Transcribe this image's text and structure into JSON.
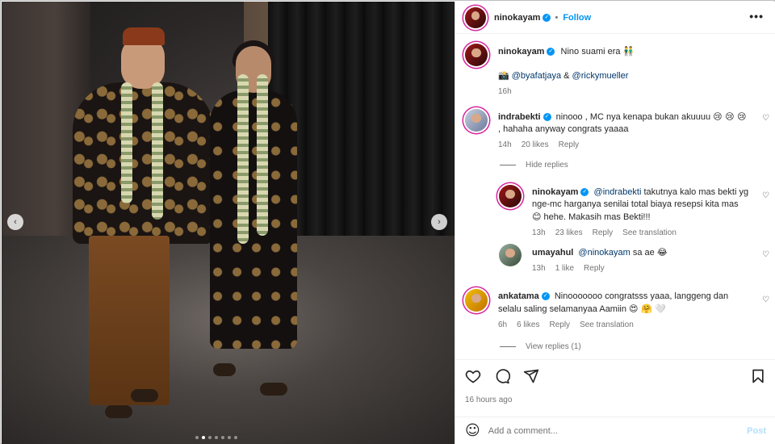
{
  "post": {
    "author": "ninokayam",
    "follow_label": "Follow",
    "more_label": "•••",
    "caption": {
      "text": "Nino suami era",
      "emoji": "👬",
      "tag_prefix": "📸",
      "tag1": "@byafatjaya",
      "amp": "&",
      "tag2": "@rickymueller",
      "time": "16h"
    },
    "carousel": {
      "prev_label": "‹",
      "next_label": "›",
      "slide_count": 7,
      "active_index": 1
    }
  },
  "comments": [
    {
      "user": "indrabekti",
      "verified": true,
      "text": "ninooo , MC nya kenapa bukan akuuuu",
      "emoji": "😢 😢 😢",
      "text2": ", hahaha anyway congrats yaaaa",
      "time": "14h",
      "likes": "20 likes",
      "reply_label": "Reply",
      "hide_replies": "Hide replies",
      "replies": [
        {
          "user": "ninokayam",
          "verified": true,
          "mention": "@indrabekti",
          "text": "takutnya kalo mas bekti yg",
          "text2": "nge-mc harganya senilai total biaya resepsi kita mas",
          "emoji": "😊",
          "text3": "hehe. Makasih mas Bekti!!!",
          "time": "13h",
          "likes": "23 likes",
          "reply_label": "Reply",
          "translation": "See translation"
        },
        {
          "user": "umayahul",
          "verified": false,
          "mention": "@ninokayam",
          "text": "sa ae",
          "emoji": "😂",
          "time": "13h",
          "likes": "1 like",
          "reply_label": "Reply"
        }
      ]
    },
    {
      "user": "ankatama",
      "verified": true,
      "text": "Ninooooooo congratsss yaaa, langgeng dan",
      "text2": "selalu saling selamanyaa Aamiin",
      "emoji": "😍 🤗 🤍",
      "time": "6h",
      "likes": "6 likes",
      "reply_label": "Reply",
      "translation": "See translation",
      "view_replies": "View replies (1)"
    }
  ],
  "footer": {
    "time_ago": "16 hours ago",
    "add_comment_placeholder": "Add a comment...",
    "post_label": "Post"
  },
  "icons": {
    "heart": "♡",
    "verified": "✓",
    "emoji_face": "☺"
  },
  "colors": {
    "accent": "#0095f6",
    "mention": "#00376b",
    "secondary": "#737373",
    "post_disabled": "#b2dffc"
  }
}
